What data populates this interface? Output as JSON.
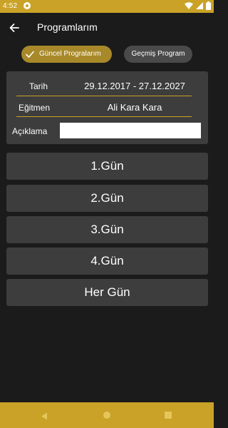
{
  "status_bar": {
    "time": "4:52"
  },
  "app_bar": {
    "title": "Programlarım",
    "back_icon": "arrow-left-icon"
  },
  "tabs": {
    "current_label": "Güncel Progralarım",
    "past_label": "Geçmiş Program",
    "current_selected": true
  },
  "info": {
    "date_label": "Tarih",
    "date_value": "29.12.2017 - 27.12.2027",
    "trainer_label": "Eğitmen",
    "trainer_value": "Ali Kara Kara",
    "note_label": "Açıklama",
    "note_value": ""
  },
  "days": [
    "1.Gün",
    "2.Gün",
    "3.Gün",
    "4.Gün",
    "Her Gün"
  ],
  "colors": {
    "accent": "#c9a227",
    "background": "#1b1b1b",
    "card": "#3d3d3d",
    "selected_tab": "#a8892a",
    "unselected_tab": "#4a4a4a"
  }
}
